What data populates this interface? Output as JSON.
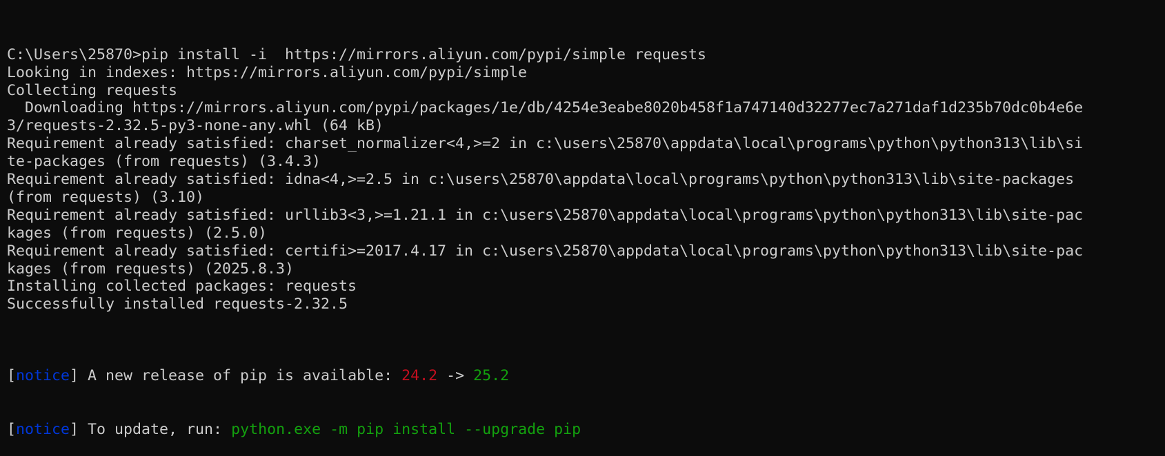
{
  "colors": {
    "background": "#0c0c0c",
    "text": "#cccccc",
    "notice": "#0037da",
    "old_version": "#c50f1f",
    "new_version": "#13a10e"
  },
  "lines": [
    "C:\\Users\\25870>pip install -i  https://mirrors.aliyun.com/pypi/simple requests",
    "Looking in indexes: https://mirrors.aliyun.com/pypi/simple",
    "Collecting requests",
    "  Downloading https://mirrors.aliyun.com/pypi/packages/1e/db/4254e3eabe8020b458f1a747140d32277ec7a271daf1d235b70dc0b4e6e",
    "3/requests-2.32.5-py3-none-any.whl (64 kB)",
    "Requirement already satisfied: charset_normalizer<4,>=2 in c:\\users\\25870\\appdata\\local\\programs\\python\\python313\\lib\\si",
    "te-packages (from requests) (3.4.3)",
    "Requirement already satisfied: idna<4,>=2.5 in c:\\users\\25870\\appdata\\local\\programs\\python\\python313\\lib\\site-packages",
    "(from requests) (3.10)",
    "Requirement already satisfied: urllib3<3,>=1.21.1 in c:\\users\\25870\\appdata\\local\\programs\\python\\python313\\lib\\site-pac",
    "kages (from requests) (2.5.0)",
    "Requirement already satisfied: certifi>=2017.4.17 in c:\\users\\25870\\appdata\\local\\programs\\python\\python313\\lib\\site-pac",
    "kages (from requests) (2025.8.3)",
    "Installing collected packages: requests",
    "Successfully installed requests-2.32.5",
    ""
  ],
  "notice1": {
    "open": "[",
    "tag": "notice",
    "close": "]",
    "text": " A new release of pip is available: ",
    "old": "24.2",
    "arrow": " -> ",
    "new": "25.2"
  },
  "notice2": {
    "open": "[",
    "tag": "notice",
    "close": "]",
    "text": " To update, run: ",
    "command": "python.exe -m pip install --upgrade pip"
  }
}
